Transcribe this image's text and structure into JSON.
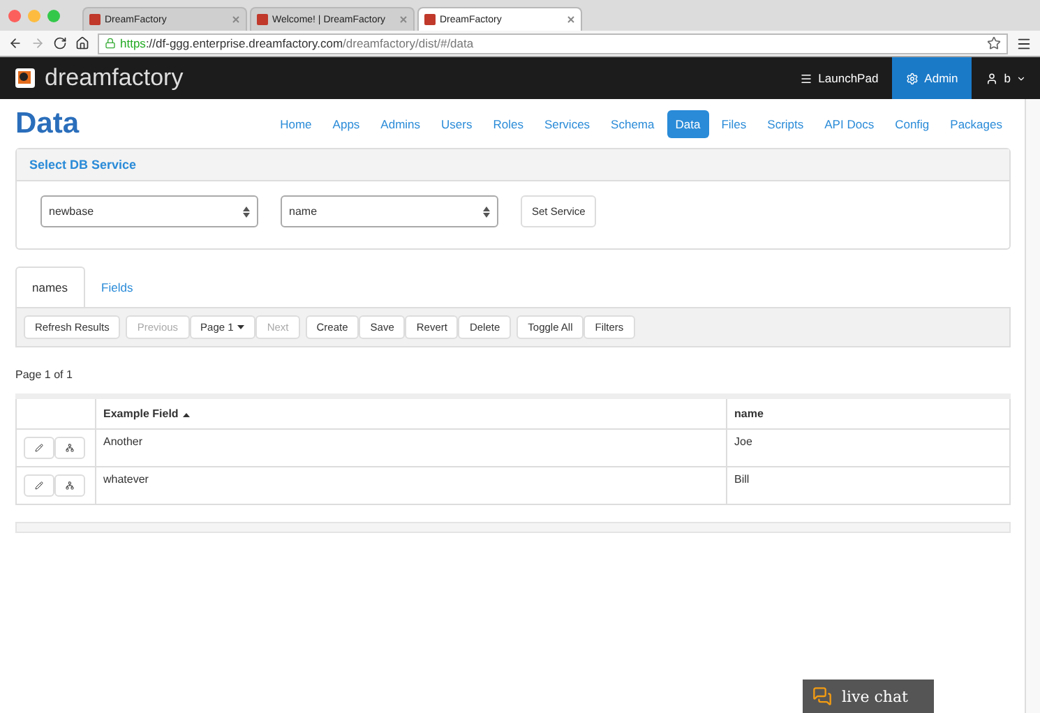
{
  "browser": {
    "tabs": [
      {
        "title": "DreamFactory",
        "selected": false
      },
      {
        "title": "Welcome! | DreamFactory",
        "selected": false
      },
      {
        "title": "DreamFactory",
        "selected": true
      }
    ],
    "url_secure": "https",
    "url_host": "://df-ggg.enterprise.dreamfactory.com",
    "url_path": "/dreamfactory/dist/#/data"
  },
  "navbar": {
    "brand": "dreamfactory",
    "items": [
      {
        "label": "LaunchPad",
        "selected": false
      },
      {
        "label": "Admin",
        "selected": true
      },
      {
        "label": "b",
        "selected": false
      }
    ]
  },
  "page": {
    "title": "Data",
    "nav": [
      {
        "label": "Home",
        "selected": false
      },
      {
        "label": "Apps",
        "selected": false
      },
      {
        "label": "Admins",
        "selected": false
      },
      {
        "label": "Users",
        "selected": false
      },
      {
        "label": "Roles",
        "selected": false
      },
      {
        "label": "Services",
        "selected": false
      },
      {
        "label": "Schema",
        "selected": false
      },
      {
        "label": "Data",
        "selected": true
      },
      {
        "label": "Files",
        "selected": false
      },
      {
        "label": "Scripts",
        "selected": false
      },
      {
        "label": "API Docs",
        "selected": false
      },
      {
        "label": "Config",
        "selected": false
      },
      {
        "label": "Packages",
        "selected": false
      }
    ]
  },
  "service_panel": {
    "title": "Select DB Service",
    "selects": [
      "newbase",
      "name"
    ],
    "button": "Set Service"
  },
  "tabs": [
    {
      "label": "names",
      "selected": true
    },
    {
      "label": "Fields",
      "selected": false
    }
  ],
  "toolbar": [
    [
      {
        "label": "Refresh Results",
        "disabled": false
      }
    ],
    [
      {
        "label": "Previous",
        "disabled": true
      },
      {
        "label": "Page 1",
        "disabled": false,
        "dropdown": true
      },
      {
        "label": "Next",
        "disabled": true
      }
    ],
    [
      {
        "label": "Create",
        "disabled": false
      },
      {
        "label": "Save",
        "disabled": false
      },
      {
        "label": "Revert",
        "disabled": false
      },
      {
        "label": "Delete",
        "disabled": false
      }
    ],
    [
      {
        "label": "Toggle All",
        "disabled": false
      },
      {
        "label": "Filters",
        "disabled": false
      }
    ]
  ],
  "pager": "Page 1 of 1",
  "table": {
    "columns": [
      {
        "label": "Example Field",
        "sorted": true
      },
      {
        "label": "name"
      }
    ],
    "rows": [
      [
        "Another",
        "Joe"
      ],
      [
        "whatever",
        "Bill"
      ]
    ]
  },
  "chat": {
    "label": "live chat"
  }
}
